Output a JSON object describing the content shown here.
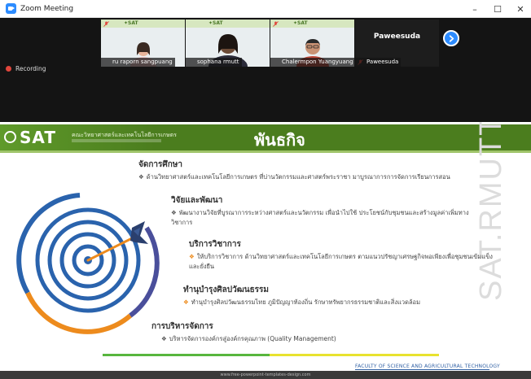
{
  "window": {
    "title": "Zoom Meeting",
    "controls": {
      "minimize": "–",
      "maximize": "☐",
      "close": "✕"
    }
  },
  "participants": [
    {
      "name": "ru raporn sangpuang",
      "muted": true
    },
    {
      "name": "sophana rmutt",
      "muted": false
    },
    {
      "name": "Chalermpon Yuangyuang",
      "muted": true
    },
    {
      "name": "Paweesuda",
      "muted": true,
      "display_name": "Paweesuda"
    }
  ],
  "recording": {
    "label": "Recording",
    "color": "#e0463c"
  },
  "slide": {
    "logo": "SAT",
    "org_name": "คณะวิทยาศาสตร์และเทคโนโลยีการเกษตร",
    "title": "พันธกิจ",
    "watermark": "SAT.RMUTT",
    "sections": [
      {
        "heading": "จัดการศึกษา",
        "text": "ด้านวิทยาศาสตร์และเทคโนโลยีการเกษตร ที่บ่านวัตกรรมและศาสตร์พระราชา มาบูรณาการการจัดการเรียนการสอน"
      },
      {
        "heading": "วิจัยและพัฒนา",
        "text": "พัฒนางานวิจัยที่บูรณาการระหว่างศาสตร์และนวัตกรรม เพื่อนำไปใช้ ประโยชน์กับชุมชนและสร้างมูลค่าเพิ่มทางวิชาการ"
      },
      {
        "heading": "บริการวิชาการ",
        "text": "ให้บริการวิชาการ ด้านวิทยาศาสตร์และเทคโนโลยีการเกษตร ตามแนวปรัชญาเศรษฐกิจพอเพียงเพื่อชุมชนเข้มแข็ง และยั่งยืน"
      },
      {
        "heading": "ทำนุบำรุงศิลปวัฒนธรรม",
        "text": "ทำนุบำรุงศิลปวัฒนธรรมไทย ภูมิปัญญาท้องถิ่น รักษาทรัพยากรธรรมชาติและสิ่งแวดล้อม"
      },
      {
        "heading": "การบริหารจัดการ",
        "text": "บริหารจัดการองค์กรสู่องค์กรคุณภาพ (Quality Management)"
      }
    ],
    "faculty": "FACULTY OF SCIENCE AND AGRICULTURAL TECHNOLOGY",
    "footer": "www.free-powerpoint-templates-design.com"
  },
  "colors": {
    "header_green": "#4b7d1e",
    "zoom_blue": "#2d8cff",
    "accent_orange": "#ed8b1d",
    "bar_green": "#58b63e",
    "bar_yellow": "#e8e22f"
  }
}
